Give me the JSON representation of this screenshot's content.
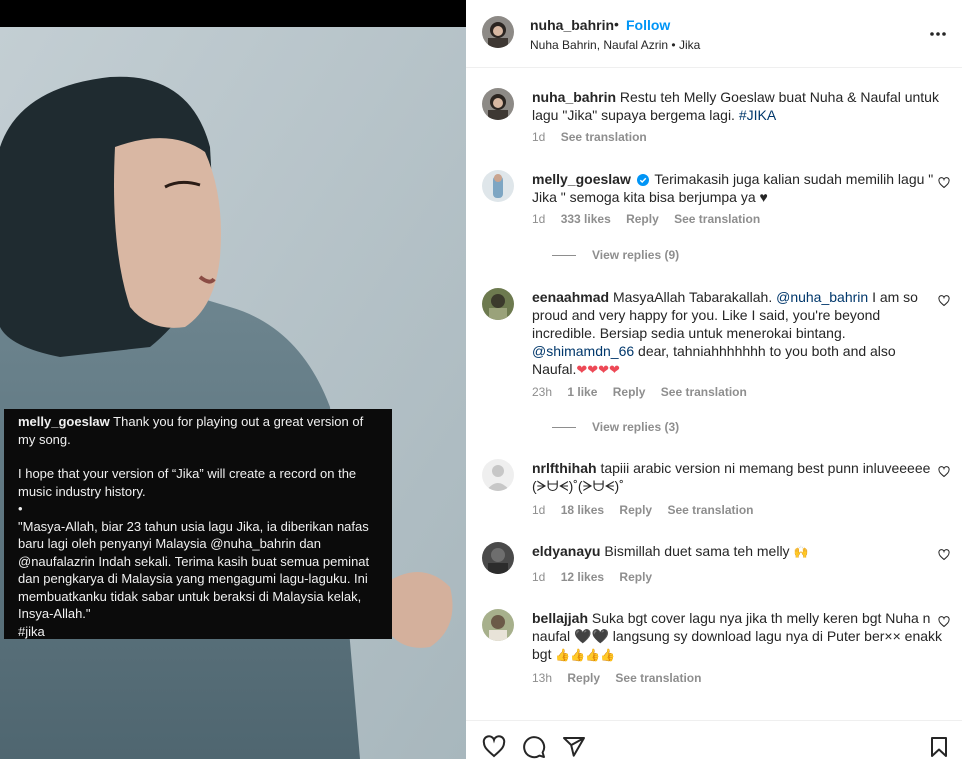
{
  "overlay": {
    "username": "melly_goeslaw",
    "line1": "Thank you for playing out a great version of my song.",
    "line2": "I hope that your version of “Jika” will create a record on the music industry history.",
    "bullet": "•",
    "line3": "\"Masya-Allah, biar 23 tahun usia lagu Jika, ia diberikan nafas baru lagi oleh penyanyi Malaysia @nuha_bahrin dan @naufalazrin Indah sekali. Terima kasih buat semua peminat dan pengkarya di Malaysia yang mengagumi lagu-laguku. Ini membuatkanku tidak sabar untuk beraksi di Malaysia kelak, Insya-Allah.\"",
    "hashtag": "#jika"
  },
  "header": {
    "username": "nuha_bahrin",
    "dot": "•",
    "follow": "Follow",
    "subtitle": "Nuha Bahrin, Naufal Azrin • Jika"
  },
  "caption": {
    "username": "nuha_bahrin",
    "text": "Restu teh Melly Goeslaw buat Nuha & Naufal untuk lagu \"Jika\" supaya bergema lagi.",
    "hashtag": "#JIKA",
    "time": "1d",
    "translation": "See translation"
  },
  "comments": [
    {
      "username": "melly_goeslaw",
      "text": "Terimakasih juga kalian sudah memilih lagu \" Jika \" semoga kita bisa berjumpa ya",
      "suffix": "♥",
      "time": "1d",
      "likes": "333 likes",
      "reply": "Reply",
      "translation": "See translation",
      "view_replies": "View replies (9)"
    },
    {
      "username": "eenaahmad",
      "text_a": "MasyaAllah Tabarakallah.",
      "mention_a": "@nuha_bahrin",
      "text_b": "I am so proud and very happy for you. Like I said, you're beyond incredible. Bersiap sedia untuk menerokai bintang.",
      "mention_b": "@shimamdn_66",
      "text_c": "dear, tahniahhhhhhh to you both and also Naufal.",
      "hearts": "❤❤❤❤",
      "time": "23h",
      "likes": "1 like",
      "reply": "Reply",
      "translation": "See translation",
      "view_replies": "View replies (3)"
    },
    {
      "username": "nrlfthihah",
      "text": "tapiii arabic version ni memang best punn inluveeeee (ᗒᗨᗕ)˚(ᗒᗨᗕ)˚",
      "time": "1d",
      "likes": "18 likes",
      "reply": "Reply",
      "translation": "See translation"
    },
    {
      "username": "eldyanayu",
      "text": "Bismillah duet sama teh melly",
      "emoji": "🙌",
      "time": "1d",
      "likes": "12 likes",
      "reply": "Reply"
    },
    {
      "username": "bellajjah",
      "text": "Suka bgt cover lagu nya jika th melly keren bgt Nuha n naufal 🖤🖤 langsung sy download lagu nya di Puter ber×× enakk bgt",
      "emoji": "👍👍👍👍",
      "time": "13h",
      "reply": "Reply",
      "translation": "See translation"
    }
  ],
  "icons": {
    "like": "heart-icon",
    "comment": "comment-icon",
    "share": "share-icon",
    "save": "bookmark-icon",
    "more": "more-icon",
    "verified": "verified-badge-icon"
  },
  "colors": {
    "link": "#00376b",
    "follow": "#0095f6",
    "muted": "#8e8e8e",
    "verified": "#0095f6",
    "heart_red": "#ed4956"
  }
}
